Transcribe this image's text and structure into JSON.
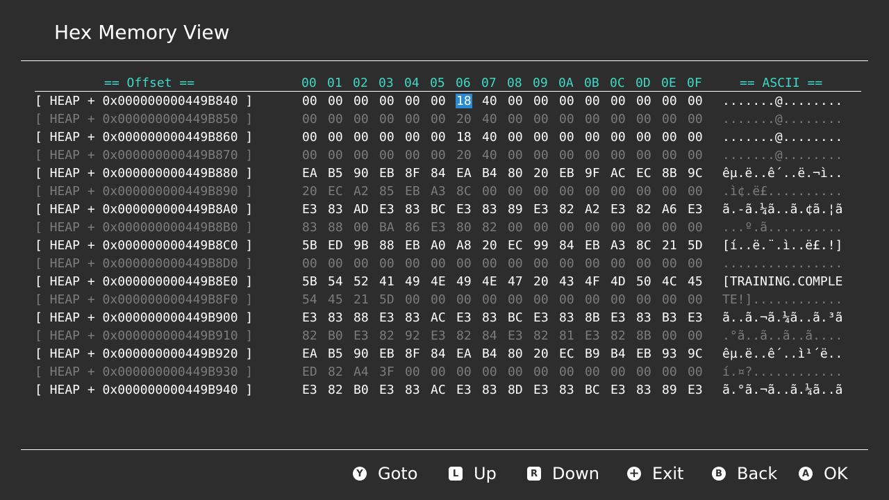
{
  "header": {
    "title": "Hex Memory View"
  },
  "table": {
    "offset_label": "== Offset ==",
    "ascii_label": "== ASCII ==",
    "columns": [
      "00",
      "01",
      "02",
      "03",
      "04",
      "05",
      "06",
      "07",
      "08",
      "09",
      "0A",
      "0B",
      "0C",
      "0D",
      "0E",
      "0F"
    ],
    "selected": {
      "row": 0,
      "col": 6
    },
    "rows": [
      {
        "addr": "[ HEAP + 0x000000000449B840 ]",
        "bytes": [
          "00",
          "00",
          "00",
          "00",
          "00",
          "00",
          "18",
          "40",
          "00",
          "00",
          "00",
          "00",
          "00",
          "00",
          "00",
          "00"
        ],
        "ascii": ".......@........"
      },
      {
        "addr": "[ HEAP + 0x000000000449B850 ]",
        "bytes": [
          "00",
          "00",
          "00",
          "00",
          "00",
          "00",
          "20",
          "40",
          "00",
          "00",
          "00",
          "00",
          "00",
          "00",
          "00",
          "00"
        ],
        "ascii": ".......@........"
      },
      {
        "addr": "[ HEAP + 0x000000000449B860 ]",
        "bytes": [
          "00",
          "00",
          "00",
          "00",
          "00",
          "00",
          "18",
          "40",
          "00",
          "00",
          "00",
          "00",
          "00",
          "00",
          "00",
          "00"
        ],
        "ascii": ".......@........"
      },
      {
        "addr": "[ HEAP + 0x000000000449B870 ]",
        "bytes": [
          "00",
          "00",
          "00",
          "00",
          "00",
          "00",
          "20",
          "40",
          "00",
          "00",
          "00",
          "00",
          "00",
          "00",
          "00",
          "00"
        ],
        "ascii": ".......@........"
      },
      {
        "addr": "[ HEAP + 0x000000000449B880 ]",
        "bytes": [
          "EA",
          "B5",
          "90",
          "EB",
          "8F",
          "84",
          "EA",
          "B4",
          "80",
          "20",
          "EB",
          "9F",
          "AC",
          "EC",
          "8B",
          "9C"
        ],
        "ascii": "êµ.ë..ê´..ë.¬ì.."
      },
      {
        "addr": "[ HEAP + 0x000000000449B890 ]",
        "bytes": [
          "20",
          "EC",
          "A2",
          "85",
          "EB",
          "A3",
          "8C",
          "00",
          "00",
          "00",
          "00",
          "00",
          "00",
          "00",
          "00",
          "00"
        ],
        "ascii": ".ì¢.ë£.........."
      },
      {
        "addr": "[ HEAP + 0x000000000449B8A0 ]",
        "bytes": [
          "E3",
          "83",
          "AD",
          "E3",
          "83",
          "BC",
          "E3",
          "83",
          "89",
          "E3",
          "82",
          "A2",
          "E3",
          "82",
          "A6",
          "E3"
        ],
        "ascii": "ã.-ã.¼ã..ã.¢ã.¦ã"
      },
      {
        "addr": "[ HEAP + 0x000000000449B8B0 ]",
        "bytes": [
          "83",
          "88",
          "00",
          "BA",
          "86",
          "E3",
          "80",
          "82",
          "00",
          "00",
          "00",
          "00",
          "00",
          "00",
          "00",
          "00"
        ],
        "ascii": "...º.ã.........."
      },
      {
        "addr": "[ HEAP + 0x000000000449B8C0 ]",
        "bytes": [
          "5B",
          "ED",
          "9B",
          "88",
          "EB",
          "A0",
          "A8",
          "20",
          "EC",
          "99",
          "84",
          "EB",
          "A3",
          "8C",
          "21",
          "5D"
        ],
        "ascii": "[í..ë.¨.ì..ë£.!]"
      },
      {
        "addr": "[ HEAP + 0x000000000449B8D0 ]",
        "bytes": [
          "00",
          "00",
          "00",
          "00",
          "00",
          "00",
          "00",
          "00",
          "00",
          "00",
          "00",
          "00",
          "00",
          "00",
          "00",
          "00"
        ],
        "ascii": "................"
      },
      {
        "addr": "[ HEAP + 0x000000000449B8E0 ]",
        "bytes": [
          "5B",
          "54",
          "52",
          "41",
          "49",
          "4E",
          "49",
          "4E",
          "47",
          "20",
          "43",
          "4F",
          "4D",
          "50",
          "4C",
          "45"
        ],
        "ascii": "[TRAINING.COMPLE"
      },
      {
        "addr": "[ HEAP + 0x000000000449B8F0 ]",
        "bytes": [
          "54",
          "45",
          "21",
          "5D",
          "00",
          "00",
          "00",
          "00",
          "00",
          "00",
          "00",
          "00",
          "00",
          "00",
          "00",
          "00"
        ],
        "ascii": "TE!]............"
      },
      {
        "addr": "[ HEAP + 0x000000000449B900 ]",
        "bytes": [
          "E3",
          "83",
          "88",
          "E3",
          "83",
          "AC",
          "E3",
          "83",
          "BC",
          "E3",
          "83",
          "8B",
          "E3",
          "83",
          "B3",
          "E3"
        ],
        "ascii": "ã..ã.¬ã.¼ã..ã.³ã"
      },
      {
        "addr": "[ HEAP + 0x000000000449B910 ]",
        "bytes": [
          "82",
          "B0",
          "E3",
          "82",
          "92",
          "E3",
          "82",
          "84",
          "E3",
          "82",
          "81",
          "E3",
          "82",
          "8B",
          "00",
          "00"
        ],
        "ascii": ".°ã..ã..ã..ã...."
      },
      {
        "addr": "[ HEAP + 0x000000000449B920 ]",
        "bytes": [
          "EA",
          "B5",
          "90",
          "EB",
          "8F",
          "84",
          "EA",
          "B4",
          "80",
          "20",
          "EC",
          "B9",
          "B4",
          "EB",
          "93",
          "9C"
        ],
        "ascii": "êµ.ë..ê´..ì¹´ë.."
      },
      {
        "addr": "[ HEAP + 0x000000000449B930 ]",
        "bytes": [
          "ED",
          "82",
          "A4",
          "3F",
          "00",
          "00",
          "00",
          "00",
          "00",
          "00",
          "00",
          "00",
          "00",
          "00",
          "00",
          "00"
        ],
        "ascii": "í.¤?............"
      },
      {
        "addr": "[ HEAP + 0x000000000449B940 ]",
        "bytes": [
          "E3",
          "82",
          "B0",
          "E3",
          "83",
          "AC",
          "E3",
          "83",
          "8D",
          "E3",
          "83",
          "BC",
          "E3",
          "83",
          "89",
          "E3"
        ],
        "ascii": "ã.°ã.¬ã..ã.¼ã..ã"
      }
    ]
  },
  "footer": {
    "items": [
      {
        "icon": "Y",
        "icon_name": "y-button-icon",
        "shape": "round",
        "label": "Goto"
      },
      {
        "icon": "L",
        "icon_name": "l-button-icon",
        "shape": "square",
        "label": "Up"
      },
      {
        "icon": "R",
        "icon_name": "r-button-icon",
        "shape": "square",
        "label": "Down"
      },
      {
        "icon": "+",
        "icon_name": "plus-button-icon",
        "shape": "round",
        "label": "Exit"
      },
      {
        "icon": "B",
        "icon_name": "b-button-icon",
        "shape": "round",
        "label": "Back"
      },
      {
        "icon": "A",
        "icon_name": "a-button-icon",
        "shape": "round",
        "label": "OK"
      }
    ]
  },
  "colors": {
    "background": "#2d2d2d",
    "accent": "#3fd8c4",
    "selection": "#2a8ad3",
    "dim_text": "#7c7c7c"
  }
}
